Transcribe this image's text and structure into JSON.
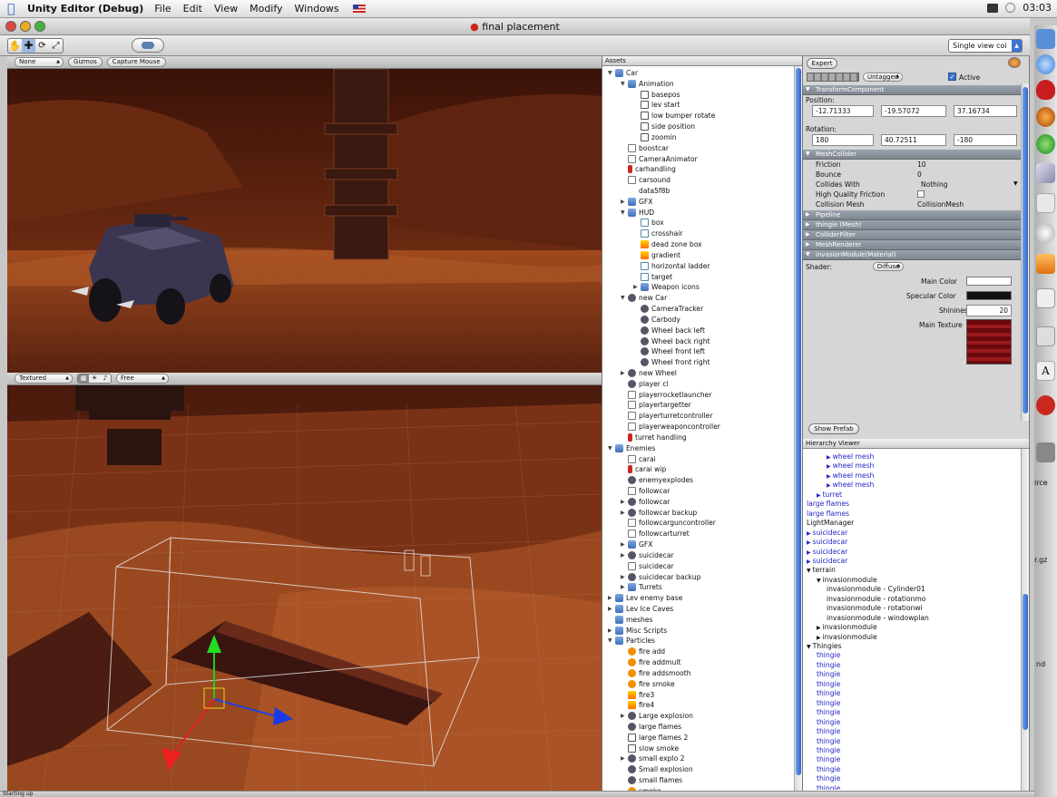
{
  "menubar": {
    "app_name": "Unity Editor (Debug)",
    "items": [
      "File",
      "Edit",
      "View",
      "Modify",
      "Windows"
    ],
    "clock": "03:03"
  },
  "window": {
    "title": "final placement"
  },
  "toolbar": {
    "layout_select": "Single view coi"
  },
  "game_view": {
    "aspect_popup": "None",
    "gizmos_button": "Gizmos",
    "capture_button": "Capture Mouse"
  },
  "scene_view": {
    "render_mode": "Textured",
    "camera_mode": "Free"
  },
  "assets": {
    "header": "Assets",
    "items": [
      {
        "label": "Car",
        "depth": 0,
        "icon": "folder",
        "arrow": "open"
      },
      {
        "label": "Animation",
        "depth": 1,
        "icon": "folder",
        "arrow": "open"
      },
      {
        "label": "basepos",
        "depth": 2,
        "icon": "anim"
      },
      {
        "label": "lev start",
        "depth": 2,
        "icon": "anim"
      },
      {
        "label": "low bumper rotate",
        "depth": 2,
        "icon": "anim"
      },
      {
        "label": "side position",
        "depth": 2,
        "icon": "anim"
      },
      {
        "label": "zoomin",
        "depth": 2,
        "icon": "anim"
      },
      {
        "label": "boostcar",
        "depth": 1,
        "icon": "script"
      },
      {
        "label": "CameraAnimator",
        "depth": 1,
        "icon": "script"
      },
      {
        "label": "carhandling",
        "depth": 1,
        "icon": "red"
      },
      {
        "label": "carsound",
        "depth": 1,
        "icon": "script"
      },
      {
        "label": "data5f8b",
        "depth": 1,
        "icon": "none"
      },
      {
        "label": "GFX",
        "depth": 1,
        "icon": "folder",
        "arrow": "closed"
      },
      {
        "label": "HUD",
        "depth": 1,
        "icon": "folder",
        "arrow": "open"
      },
      {
        "label": "box",
        "depth": 2,
        "icon": "tex"
      },
      {
        "label": "crosshair",
        "depth": 2,
        "icon": "tex"
      },
      {
        "label": "dead zone box",
        "depth": 2,
        "icon": "grad"
      },
      {
        "label": "gradient",
        "depth": 2,
        "icon": "grad"
      },
      {
        "label": "horizontal ladder",
        "depth": 2,
        "icon": "tex"
      },
      {
        "label": "target",
        "depth": 2,
        "icon": "tex"
      },
      {
        "label": "Weapon icons",
        "depth": 2,
        "icon": "folder",
        "arrow": "closed"
      },
      {
        "label": "new Car",
        "depth": 1,
        "icon": "prefab",
        "arrow": "open"
      },
      {
        "label": "CameraTracker",
        "depth": 2,
        "icon": "prefab"
      },
      {
        "label": "Carbody",
        "depth": 2,
        "icon": "prefab"
      },
      {
        "label": "Wheel back left",
        "depth": 2,
        "icon": "prefab"
      },
      {
        "label": "Wheel back right",
        "depth": 2,
        "icon": "prefab"
      },
      {
        "label": "Wheel front left",
        "depth": 2,
        "icon": "prefab"
      },
      {
        "label": "Wheel front right",
        "depth": 2,
        "icon": "prefab"
      },
      {
        "label": "new Wheel",
        "depth": 1,
        "icon": "prefab",
        "arrow": "closed"
      },
      {
        "label": "player cl",
        "depth": 1,
        "icon": "prefab"
      },
      {
        "label": "playerrocketlauncher",
        "depth": 1,
        "icon": "script"
      },
      {
        "label": "playertargetter",
        "depth": 1,
        "icon": "script"
      },
      {
        "label": "playerturretcontroller",
        "depth": 1,
        "icon": "script"
      },
      {
        "label": "playerweaponcontroller",
        "depth": 1,
        "icon": "script"
      },
      {
        "label": "turret handling",
        "depth": 1,
        "icon": "red"
      },
      {
        "label": "Enemies",
        "depth": 0,
        "icon": "folder",
        "arrow": "open"
      },
      {
        "label": "carai",
        "depth": 1,
        "icon": "script"
      },
      {
        "label": "carai wip",
        "depth": 1,
        "icon": "red"
      },
      {
        "label": "enemyexplodes",
        "depth": 1,
        "icon": "prefab"
      },
      {
        "label": "followcar",
        "depth": 1,
        "icon": "script"
      },
      {
        "label": "followcar",
        "depth": 1,
        "icon": "prefab",
        "arrow": "closed"
      },
      {
        "label": "followcar backup",
        "depth": 1,
        "icon": "prefab",
        "arrow": "closed"
      },
      {
        "label": "followcarguncontroller",
        "depth": 1,
        "icon": "script"
      },
      {
        "label": "followcarturret",
        "depth": 1,
        "icon": "script"
      },
      {
        "label": "GFX",
        "depth": 1,
        "icon": "folder",
        "arrow": "closed"
      },
      {
        "label": "suicidecar",
        "depth": 1,
        "icon": "prefab",
        "arrow": "closed"
      },
      {
        "label": "suicidecar",
        "depth": 1,
        "icon": "script"
      },
      {
        "label": "suicidecar backup",
        "depth": 1,
        "icon": "prefab",
        "arrow": "closed"
      },
      {
        "label": "Turrets",
        "depth": 1,
        "icon": "folder",
        "arrow": "closed"
      },
      {
        "label": "Lev enemy base",
        "depth": 0,
        "icon": "folder",
        "arrow": "closed"
      },
      {
        "label": "Lev Ice Caves",
        "depth": 0,
        "icon": "folder",
        "arrow": "closed"
      },
      {
        "label": "meshes",
        "depth": 0,
        "icon": "folder"
      },
      {
        "label": "Misc Scripts",
        "depth": 0,
        "icon": "folder",
        "arrow": "closed"
      },
      {
        "label": "Particles",
        "depth": 0,
        "icon": "folder",
        "arrow": "open"
      },
      {
        "label": "fire add",
        "depth": 1,
        "icon": "orange"
      },
      {
        "label": "fire addmult",
        "depth": 1,
        "icon": "orange"
      },
      {
        "label": "fire addsmooth",
        "depth": 1,
        "icon": "orange"
      },
      {
        "label": "fire smoke",
        "depth": 1,
        "icon": "orange"
      },
      {
        "label": "fire3",
        "depth": 1,
        "icon": "grad"
      },
      {
        "label": "fire4",
        "depth": 1,
        "icon": "grad"
      },
      {
        "label": "Large explosion",
        "depth": 1,
        "icon": "prefab",
        "arrow": "closed"
      },
      {
        "label": "large flames",
        "depth": 1,
        "icon": "prefab"
      },
      {
        "label": "large flames 2",
        "depth": 1,
        "icon": "anim"
      },
      {
        "label": "slow smoke",
        "depth": 1,
        "icon": "anim"
      },
      {
        "label": "small explo 2",
        "depth": 1,
        "icon": "prefab",
        "arrow": "closed"
      },
      {
        "label": "Small explosion",
        "depth": 1,
        "icon": "prefab"
      },
      {
        "label": "small flames",
        "depth": 1,
        "icon": "prefab"
      },
      {
        "label": "smoke",
        "depth": 1,
        "icon": "orange"
      }
    ]
  },
  "inspector": {
    "expert_button": "Expert",
    "tag": "Untagged",
    "active_label": "Active",
    "transform": {
      "title": "TransformComponent",
      "position_label": "Position:",
      "position": [
        "-12.71333",
        "-19.57072",
        "37.16734"
      ],
      "rotation_label": "Rotation:",
      "rotation": [
        "180",
        "40.72511",
        "-180"
      ]
    },
    "meshcollider": {
      "title": "MeshCollider",
      "friction_label": "Friction",
      "friction": "10",
      "bounce_label": "Bounce",
      "bounce": "0",
      "collides_label": "Collides With",
      "collides": "Nothing",
      "hq_label": "High Quality Friction",
      "mesh_label": "Collision Mesh",
      "mesh": "CollisionMesh"
    },
    "collapsed": [
      "Pipeline",
      "thingie (Mesh)",
      "ColliderFilter",
      "MeshRenderer"
    ],
    "material": {
      "title": "invasionModule(Material)",
      "shader_label": "Shader:",
      "shader": "Diffuse",
      "main_color_label": "Main Color",
      "specular_label": "Specular Color",
      "shininess_label": "Shininess",
      "shininess": "20",
      "texture_label": "Main Texture"
    }
  },
  "hierarchy": {
    "show_prefab": "Show Prefab",
    "header": "Hierarchy Viewer",
    "items": [
      {
        "label": "wheel mesh",
        "depth": 2,
        "blue": true,
        "arrow": true
      },
      {
        "label": "wheel mesh",
        "depth": 2,
        "blue": true,
        "arrow": true
      },
      {
        "label": "wheel mesh",
        "depth": 2,
        "blue": true,
        "arrow": true
      },
      {
        "label": "wheel mesh",
        "depth": 2,
        "blue": true,
        "arrow": true
      },
      {
        "label": "turret",
        "depth": 1,
        "blue": true,
        "arrow": true
      },
      {
        "label": "large flames",
        "depth": 0,
        "blue": true
      },
      {
        "label": "large flames",
        "depth": 0,
        "blue": true
      },
      {
        "label": "LightManager",
        "depth": 0
      },
      {
        "label": "suicidecar",
        "depth": 0,
        "blue": true,
        "arrow": true
      },
      {
        "label": "suicidecar",
        "depth": 0,
        "blue": true,
        "arrow": true
      },
      {
        "label": "suicidecar",
        "depth": 0,
        "blue": true,
        "arrow": true
      },
      {
        "label": "suicidecar",
        "depth": 0,
        "blue": true,
        "arrow": true
      },
      {
        "label": "terrain",
        "depth": 0,
        "arrow": "open"
      },
      {
        "label": "invasionmodule",
        "depth": 1,
        "arrow": "open"
      },
      {
        "label": "invasionmodule - Cylinder01",
        "depth": 2
      },
      {
        "label": "invasionmodule - rotationmo",
        "depth": 2
      },
      {
        "label": "invasionmodule - rotationwi",
        "depth": 2
      },
      {
        "label": "invasionmodule - windowplan",
        "depth": 2
      },
      {
        "label": "invasionmodule",
        "depth": 1,
        "arrow": true
      },
      {
        "label": "invasionmodule",
        "depth": 1,
        "arrow": true
      },
      {
        "label": "Thingies",
        "depth": 0,
        "arrow": "open"
      },
      {
        "label": "thingie",
        "depth": 1,
        "blue": true
      },
      {
        "label": "thingie",
        "depth": 1,
        "blue": true
      },
      {
        "label": "thingie",
        "depth": 1,
        "blue": true
      },
      {
        "label": "thingie",
        "depth": 1,
        "blue": true
      },
      {
        "label": "thingie",
        "depth": 1,
        "blue": true
      },
      {
        "label": "thingie",
        "depth": 1,
        "blue": true
      },
      {
        "label": "thingie",
        "depth": 1,
        "blue": true
      },
      {
        "label": "thingie",
        "depth": 1,
        "blue": true
      },
      {
        "label": "thingie",
        "depth": 1,
        "blue": true
      },
      {
        "label": "thingie",
        "depth": 1,
        "blue": true
      },
      {
        "label": "thingie",
        "depth": 1,
        "blue": true
      },
      {
        "label": "thingie",
        "depth": 1,
        "blue": true
      },
      {
        "label": "thingie",
        "depth": 1,
        "blue": true
      },
      {
        "label": "thingie",
        "depth": 1,
        "blue": true
      },
      {
        "label": "thingie",
        "depth": 1,
        "blue": true
      }
    ]
  },
  "statusbar": {
    "text": "Starting up"
  },
  "dock_side_labels": [
    "irce",
    "r.gz",
    "nd"
  ]
}
